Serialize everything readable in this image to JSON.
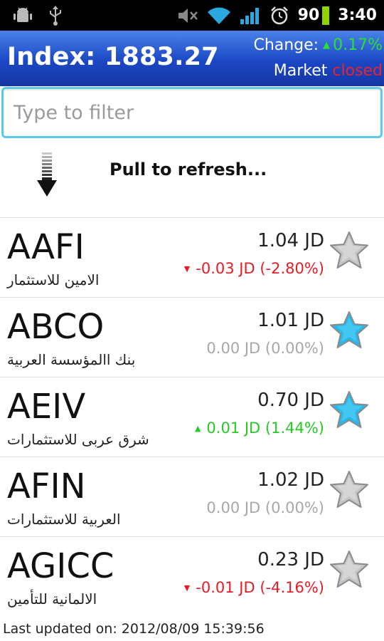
{
  "status_bar": {
    "battery": "90",
    "time": "3:40",
    "icons": [
      "android-debug-icon",
      "usb-icon",
      "mute-icon",
      "wifi-icon",
      "signal-icon",
      "alarm-icon",
      "battery-icon"
    ]
  },
  "header": {
    "index_label": "Index: 1883.27",
    "change_label": "Change:",
    "change_value": "0.17%",
    "market_label": "Market",
    "market_status": "closed"
  },
  "filter": {
    "placeholder": "Type to filter"
  },
  "refresh": {
    "label": "Pull to refresh..."
  },
  "stocks": [
    {
      "symbol": "AAFI",
      "name": "الامين للاستثمار",
      "price": "1.04 JD",
      "change": "-0.03 JD (-2.80%)",
      "direction": "down",
      "favorite": false
    },
    {
      "symbol": "ABCO",
      "name": "بنك االمؤسسة العربية",
      "price": "1.01 JD",
      "change": "0.00 JD (0.00%)",
      "direction": "flat",
      "favorite": true
    },
    {
      "symbol": "AEIV",
      "name": "شرق عربى للاستثمارات",
      "price": "0.70 JD",
      "change": "0.01 JD (1.44%)",
      "direction": "up",
      "favorite": true
    },
    {
      "symbol": "AFIN",
      "name": "العربية للاستثمارات",
      "price": "1.02 JD",
      "change": "0.00 JD (0.00%)",
      "direction": "flat",
      "favorite": false
    },
    {
      "symbol": "AGICC",
      "name": "الالمانية للتأمين",
      "price": "0.23 JD",
      "change": "-0.01 JD (-4.16%)",
      "direction": "down",
      "favorite": false
    }
  ],
  "footer": {
    "last_updated": "Last updated on: 2012/08/09 15:39:56"
  },
  "colors": {
    "header_blue": "#1b47c4",
    "up_green": "#28c828",
    "down_red": "#e31d26",
    "flat_gray": "#a8a8a8",
    "star_on": "#29b6e8",
    "star_off": "#c4c4c4",
    "filter_border": "#5ec8ea"
  }
}
